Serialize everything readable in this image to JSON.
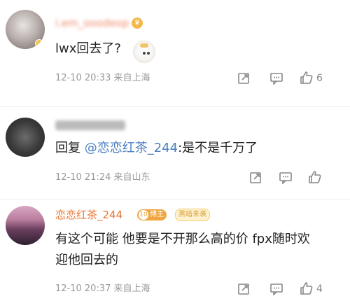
{
  "comments": [
    {
      "name": "i.em_ooodeop",
      "text": "lwx回去了?",
      "time": "12-10 20:33",
      "source": "来自上海",
      "likes": "6"
    },
    {
      "name": "",
      "reply_prefix": "回复",
      "mention": "@恋恋红茶_244",
      "text": ":是不是千万了",
      "time": "12-10 21:24",
      "source": "来自山东",
      "likes": ""
    },
    {
      "name": "恋恋红茶_244",
      "badges": {
        "level": "10",
        "blogger": "博主",
        "fans": "黑暗来袭"
      },
      "text_line1": "有这个可能 他要是不开那么高的价 fpx随时欢",
      "text_line2": "迎他回去的",
      "time": "12-10 20:37",
      "source": "来自上海",
      "likes": "4"
    }
  ],
  "colors": {
    "mention": "#4a7fc1",
    "username_highlight": "#e8732f",
    "meta": "#999999"
  }
}
